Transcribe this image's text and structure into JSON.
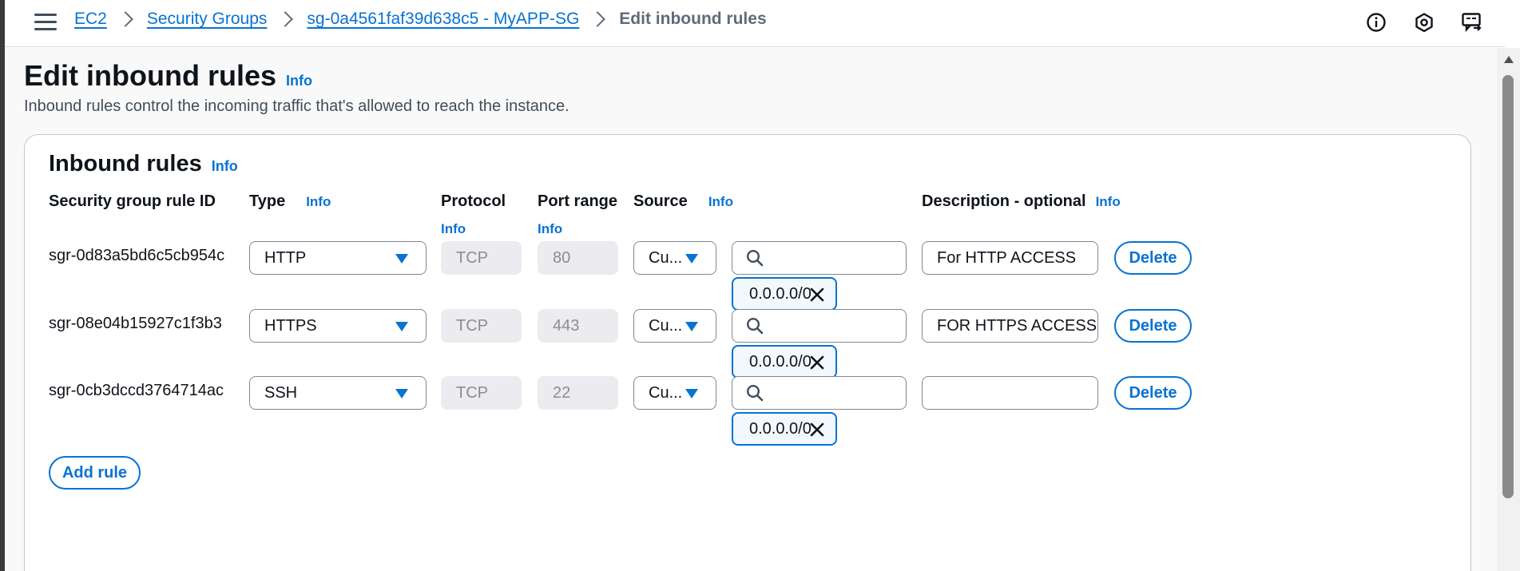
{
  "breadcrumb": {
    "items": [
      "EC2",
      "Security Groups",
      "sg-0a4561faf39d638c5 - MyAPP-SG"
    ],
    "current": "Edit inbound rules"
  },
  "page": {
    "title": "Edit inbound rules",
    "info": "Info",
    "description": "Inbound rules control the incoming traffic that's allowed to reach the instance."
  },
  "section": {
    "title": "Inbound rules",
    "info": "Info"
  },
  "columns": {
    "rule_id": "Security group rule ID",
    "type": "Type",
    "protocol": "Protocol",
    "port_range": "Port range",
    "source": "Source",
    "description": "Description - optional",
    "info": "Info"
  },
  "rules": [
    {
      "id": "sgr-0d83a5bd6c5cb954c",
      "type": "HTTP",
      "protocol": "TCP",
      "port": "80",
      "source": "Cu...",
      "cidr": "0.0.0.0/0",
      "description": "For HTTP ACCESS",
      "delete": "Delete"
    },
    {
      "id": "sgr-08e04b15927c1f3b3",
      "type": "HTTPS",
      "protocol": "TCP",
      "port": "443",
      "source": "Cu...",
      "cidr": "0.0.0.0/0",
      "description": "FOR HTTPS ACCESS",
      "delete": "Delete"
    },
    {
      "id": "sgr-0cb3dccd3764714ac",
      "type": "SSH",
      "protocol": "TCP",
      "port": "22",
      "source": "Cu...",
      "cidr": "0.0.0.0/0",
      "description": "",
      "delete": "Delete"
    }
  ],
  "add_rule_label": "Add rule",
  "colors": {
    "link": "#0972d3",
    "text": "#0f141a",
    "muted": "#5f6b7a",
    "border": "#7d8998",
    "disabled_bg": "#ebebf0"
  },
  "icons": [
    "menu-icon",
    "info-icon",
    "settings-hexagon-icon",
    "feedback-icon",
    "search-icon",
    "close-icon",
    "caret-down-icon"
  ]
}
